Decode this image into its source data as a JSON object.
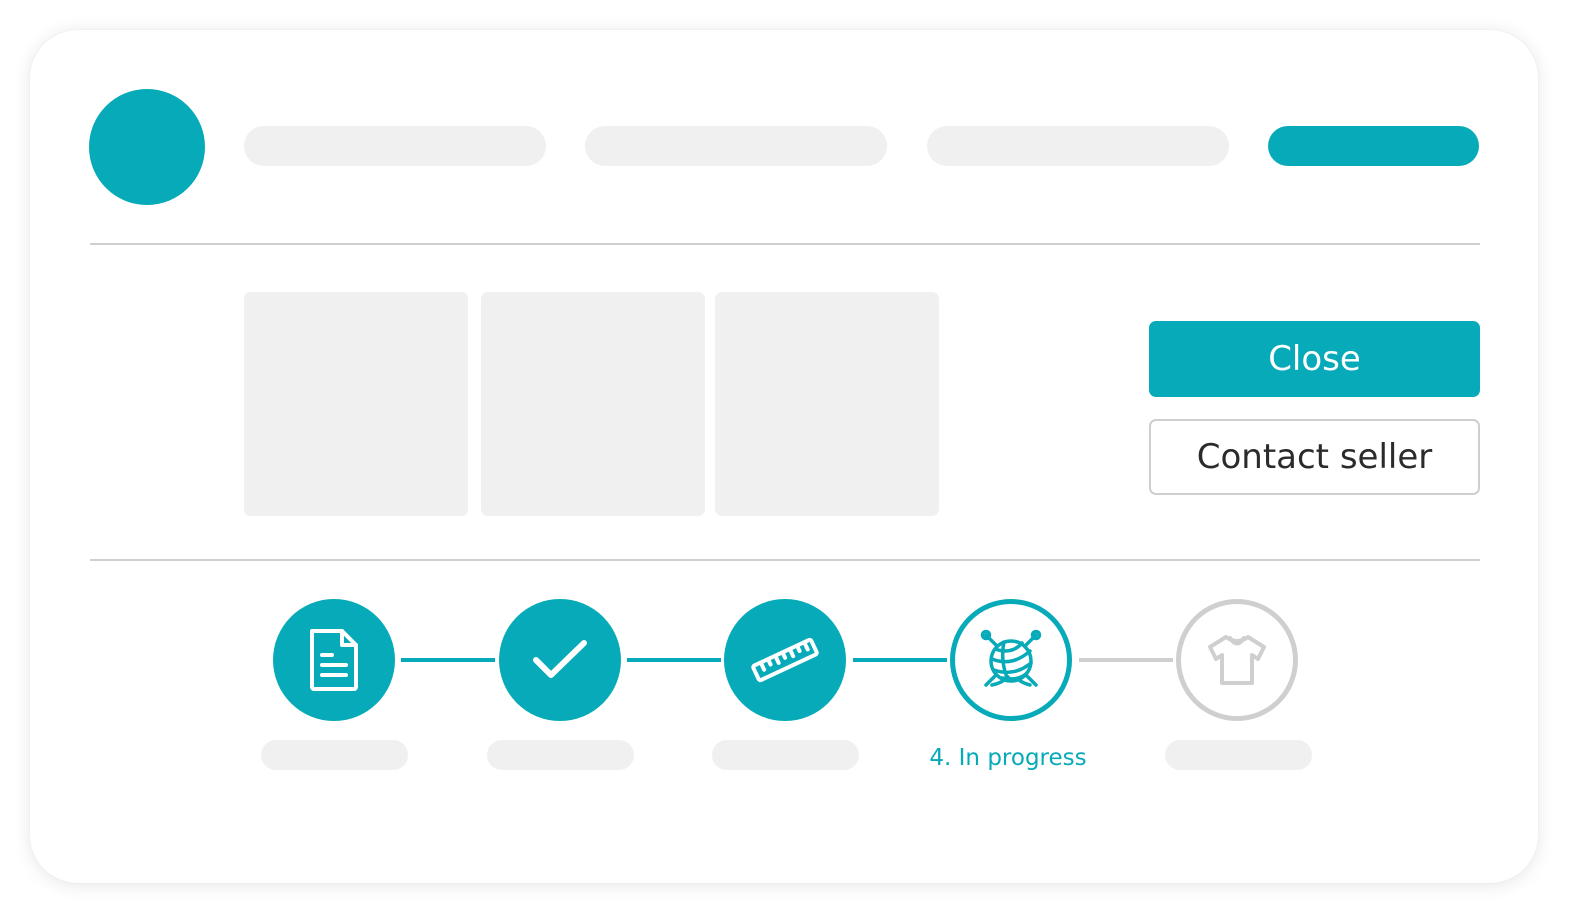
{
  "colors": {
    "accent": "#06aab8",
    "placeholder": "#f0f0f0",
    "divider": "#cfcfcf",
    "pending": "#cfcfcf"
  },
  "actions": {
    "close_label": "Close",
    "contact_label": "Contact seller"
  },
  "progress": {
    "current_step": 4,
    "steps": [
      {
        "icon": "document-icon",
        "status": "done"
      },
      {
        "icon": "checkmark-icon",
        "status": "done"
      },
      {
        "icon": "ruler-icon",
        "status": "done"
      },
      {
        "icon": "yarn-ball-icon",
        "status": "active",
        "label": "4. In progress"
      },
      {
        "icon": "t-shirt-icon",
        "status": "pending"
      }
    ]
  }
}
